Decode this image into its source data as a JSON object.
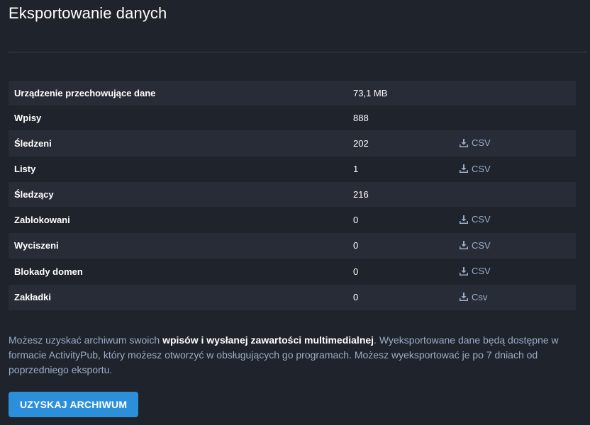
{
  "page": {
    "title": "Eksportowanie danych"
  },
  "stats": {
    "rows": [
      {
        "label": "Urządzenie przechowujące dane",
        "value": "73,1 MB",
        "action": ""
      },
      {
        "label": "Wpisy",
        "value": "888",
        "action": ""
      },
      {
        "label": "Śledzeni",
        "value": "202",
        "action": "CSV"
      },
      {
        "label": "Listy",
        "value": "1",
        "action": "CSV"
      },
      {
        "label": "Śledzący",
        "value": "216",
        "action": ""
      },
      {
        "label": "Zablokowani",
        "value": "0",
        "action": "CSV"
      },
      {
        "label": "Wyciszeni",
        "value": "0",
        "action": "CSV"
      },
      {
        "label": "Blokady domen",
        "value": "0",
        "action": "CSV"
      },
      {
        "label": "Zakładki",
        "value": "0",
        "action": "Csv"
      }
    ],
    "action_icon": "download-icon"
  },
  "hint": {
    "prefix": "Możesz uzyskać archiwum swoich ",
    "strong": "wpisów i wysłanej zawartości multimedialnej",
    "suffix": ". Wyeksportowane dane będą dostępne w formacie ActivityPub, który możesz otworzyć w obsługujących go programach. Możesz wyeksportować je po 7 dniach od poprzedniego eksportu."
  },
  "archive_button": {
    "label": "Uzyskaj archiwum"
  },
  "colors": {
    "background": "#1f232b",
    "row_alt": "#282c37",
    "link": "#9baec8",
    "button": "#2b90d9"
  }
}
